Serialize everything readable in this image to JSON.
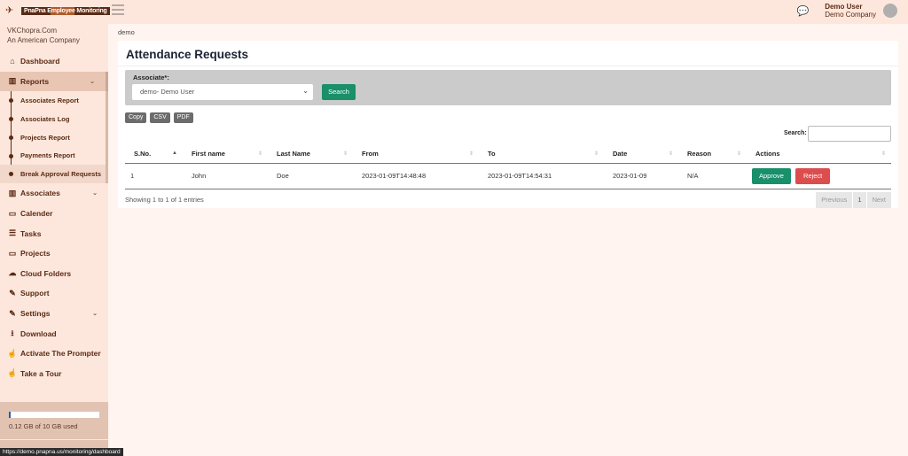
{
  "header": {
    "logo_text": "PnaPna Employee Monitoring",
    "user_name": "Demo User",
    "user_company": "Demo Company"
  },
  "sidebar": {
    "company_line1": "VKChopra.Com",
    "company_line2": "An American Company",
    "items": [
      {
        "label": "Dashboard",
        "icon": "home-icon",
        "glyph": "⌂"
      },
      {
        "label": "Reports",
        "icon": "bar-chart-icon",
        "glyph": "▥",
        "expandable": true
      },
      {
        "label": "Associates",
        "icon": "bar-chart-icon",
        "glyph": "▥",
        "expandable": true
      },
      {
        "label": "Calender",
        "icon": "calendar-icon",
        "glyph": "▭"
      },
      {
        "label": "Tasks",
        "icon": "tasks-icon",
        "glyph": "☰"
      },
      {
        "label": "Projects",
        "icon": "monitor-icon",
        "glyph": "▭"
      },
      {
        "label": "Cloud Folders",
        "icon": "cloud-icon",
        "glyph": "☁"
      },
      {
        "label": "Support",
        "icon": "support-icon",
        "glyph": "✎"
      },
      {
        "label": "Settings",
        "icon": "edit-icon",
        "glyph": "✎",
        "expandable": true
      },
      {
        "label": "Download",
        "icon": "download-icon",
        "glyph": "⭳"
      },
      {
        "label": "Activate The Prompter",
        "icon": "hand-pointer-icon",
        "glyph": "☝"
      },
      {
        "label": "Take a Tour",
        "icon": "hand-pointer-icon",
        "glyph": "☝"
      }
    ],
    "reports_sub": [
      "Associates Report",
      "Associates Log",
      "Projects Report",
      "Payments Report",
      "Break Approval Requests"
    ],
    "storage": {
      "used_fraction": 0.012,
      "text": "0.12 GB of 10 GB used"
    }
  },
  "status_url": "https://demo.pnapna.us/monitoring/dashboard",
  "breadcrumb": "demo",
  "page": {
    "title": "Attendance Requests",
    "filter_label": "Associate*:",
    "associate_selected": "demo- Demo User",
    "search_button": "Search",
    "export_buttons": [
      "Copy",
      "CSV",
      "PDF"
    ],
    "search_label": "Search:",
    "search_value": ""
  },
  "table": {
    "columns": [
      "S.No.",
      "First name",
      "Last Name",
      "From",
      "To",
      "Date",
      "Reason",
      "Actions"
    ],
    "rows": [
      {
        "sno": "1",
        "first": "John",
        "last": "Doe",
        "from": "2023-01-09T14:48:48",
        "to": "2023-01-09T14:54:31",
        "date": "2023-01-09",
        "reason": "N/A"
      }
    ],
    "approve_label": "Approve",
    "reject_label": "Reject",
    "info": "Showing 1 to 1 of 1 entries",
    "pager": {
      "previous": "Previous",
      "current": "1",
      "next": "Next"
    }
  }
}
